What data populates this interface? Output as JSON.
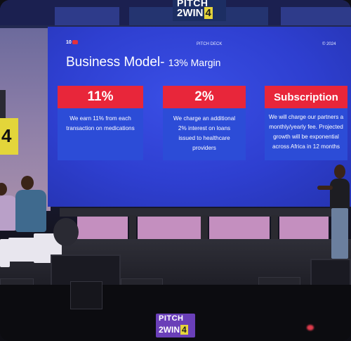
{
  "banner": {
    "line1": "PITCH",
    "line2": "2WIN",
    "box": "4"
  },
  "left_wall": {
    "big_letter": "4"
  },
  "slide": {
    "brand_num": "10",
    "brand_mark": "mg",
    "deck_label": "PITCH DECK",
    "year": "© 2024",
    "title": "Business Model- ",
    "title_suffix": "13% Margin",
    "cards": [
      {
        "head": "11%",
        "body": "We earn 11% from each transaction on medications"
      },
      {
        "head": "2%",
        "body": "We charge an additional 2% interest on loans issued to healthcare providers"
      },
      {
        "head": "Subscription",
        "body": "We will charge our partners a monthly/yearly fee. Projected growth will be exponential across Africa in 12 months"
      }
    ]
  },
  "bottom_logo": {
    "line1": "PITCH",
    "line2": "2WIN",
    "box": "4"
  },
  "colors": {
    "screen_blue": "#2e3fd0",
    "card_red": "#e8263a",
    "card_blue": "#2c4cd7",
    "logo_purple": "#6a3fb8",
    "accent_yellow": "#e6d53a"
  }
}
